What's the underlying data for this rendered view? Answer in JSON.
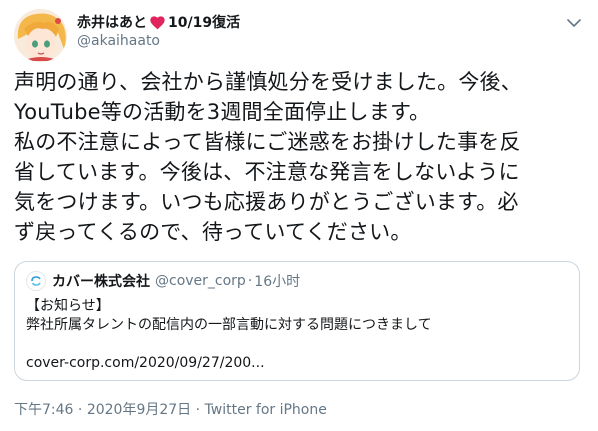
{
  "author": {
    "display_name": "赤井はあと",
    "display_suffix": "10/19復活",
    "handle": "@akaihaato",
    "avatar": "avatar-image",
    "heart_color": "#e0245e"
  },
  "menu": {
    "icon": "chevron-down-icon"
  },
  "tweet": {
    "text": "声明の通り、会社から謹慎処分を受けました。今後、\nYouTube等の活動を3週間全面停止します。\n私の不注意によって皆様にご迷惑をお掛けした事を反\n省しています。今後は、不注意な発言をしないように\n気をつけます。いつも応援ありがとうございます。必\nず戻ってくるので、待っていてください。"
  },
  "quote": {
    "name": "カバー株式会社",
    "handle": "@cover_corp",
    "separator": "·",
    "time": "16小时",
    "line1": "【お知らせ】",
    "line2": "弊社所属タレントの配信内の一部言動に対する問題につきまして",
    "link": "cover-corp.com/2020/09/27/200..."
  },
  "meta": {
    "time": "下午7:46",
    "separator1": " · ",
    "date": "2020年9月27日",
    "separator2": " · ",
    "source": "Twitter for iPhone"
  },
  "colors": {
    "text": "#14171a",
    "secondary": "#657786",
    "border": "#ccd6dd",
    "heart": "#e0245e"
  }
}
